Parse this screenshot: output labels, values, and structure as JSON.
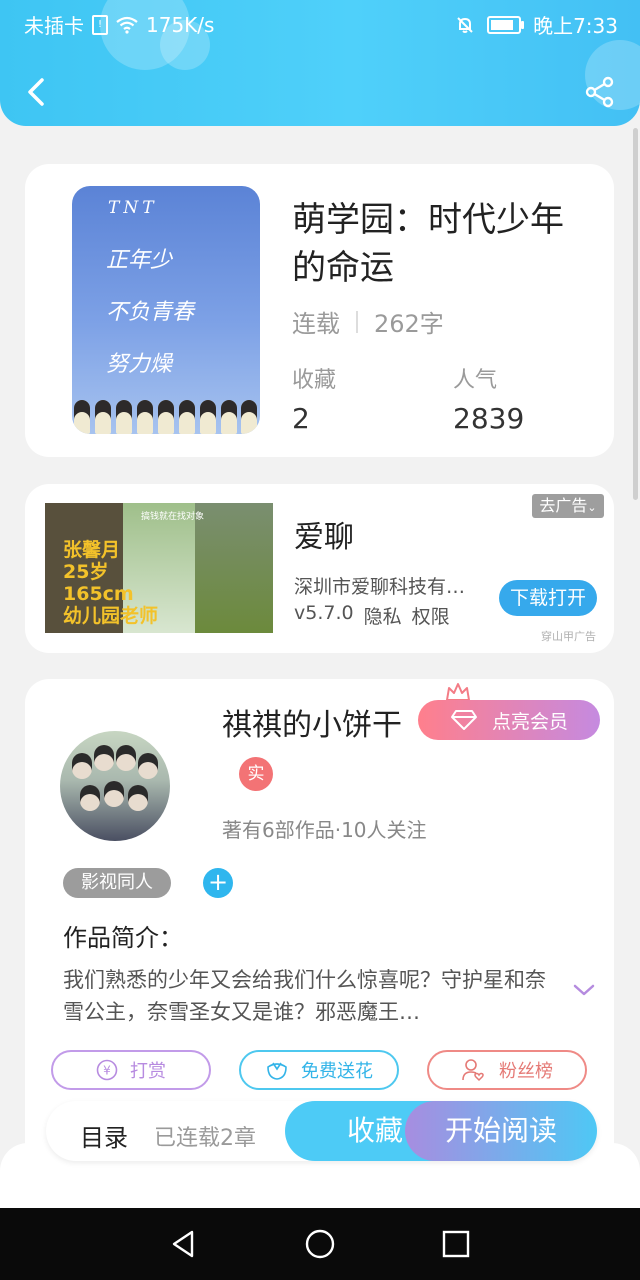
{
  "status_bar": {
    "carrier": "未插卡",
    "speed": "175K/s",
    "time": "晚上7:33",
    "battery_level": 0.85
  },
  "header": {
    "back_icon": "chevron-left-icon",
    "share_icon": "share-icon"
  },
  "book": {
    "cover_lines": [
      "TNT",
      "正年少",
      "不负青春",
      "努力燥"
    ],
    "title": "萌学园：时代少年的命运",
    "status": "连载",
    "word_count": "262字",
    "collect_label": "收藏",
    "collect_value": "2",
    "popularity_label": "人气",
    "popularity_value": "2839"
  },
  "ad": {
    "image_text": [
      "张馨月",
      "25岁",
      "165cm",
      "幼儿园老师"
    ],
    "image_caption": "搞钱就在找对象",
    "app_name": "爱聊",
    "company": "深圳市爱聊科技有限公司",
    "version": "v5.7.0",
    "privacy": "隐私",
    "permission": "权限",
    "close_label": "去广告",
    "download_label": "下载打开",
    "source": "穿山甲广告"
  },
  "author": {
    "name": "祺祺的小饼干",
    "vip_label": "点亮会员",
    "verified_label": "实",
    "works_info": "著有6部作品·10人关注",
    "tag": "影视同人",
    "add_tag": "+",
    "intro_title": "作品简介：",
    "intro": "我们熟悉的少年又会给我们什么惊喜呢？守护星和奈雪公主，奈雪圣女又是谁？邪恶魔王…",
    "reward_label": "打赏",
    "flower_label": "免费送花",
    "fans_label": "粉丝榜"
  },
  "bottom": {
    "toc_label": "目录",
    "toc_sub": "已连载2章",
    "collect_button": "收藏",
    "read_button": "开始阅读"
  },
  "colors": {
    "header_blue": "#43c4f5",
    "accent_blue": "#36a9ec",
    "vip_pink": "#ff7f8c",
    "vip_purple": "#c58ae0",
    "reward_purple": "#c29be9",
    "flower_cyan": "#4ec8ef",
    "fans_red": "#ef8a86"
  }
}
